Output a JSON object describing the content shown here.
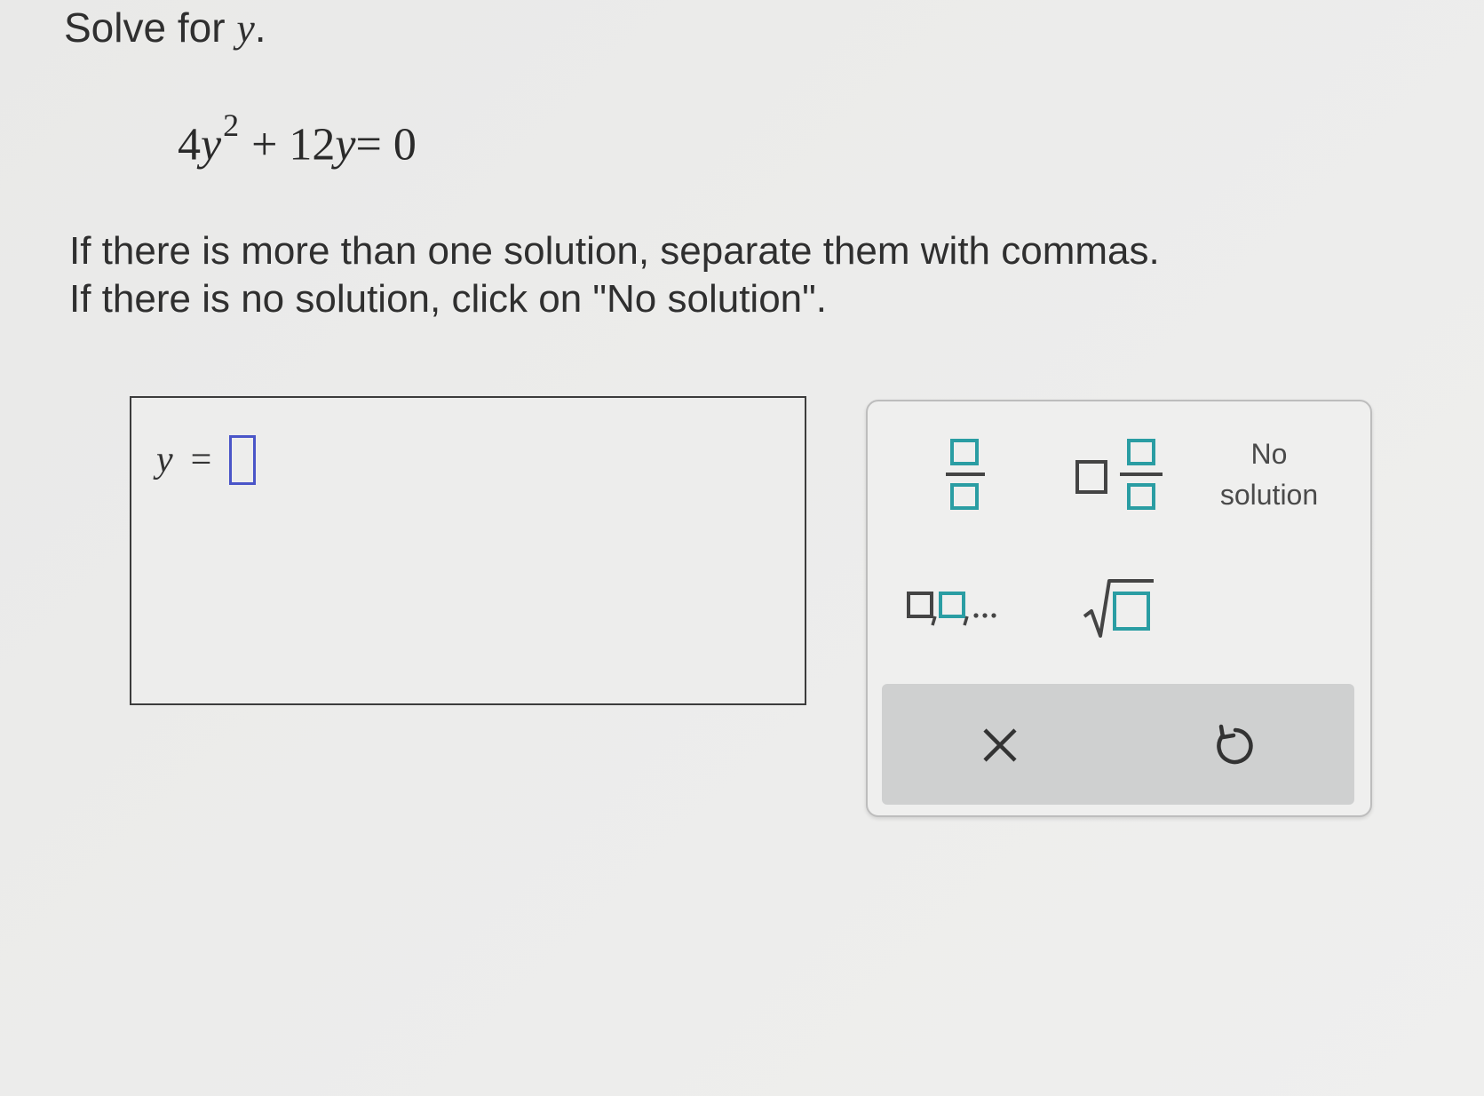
{
  "prompt": {
    "lead": "Solve for ",
    "variable": "y",
    "tail": "."
  },
  "equation": {
    "coef1": "4",
    "var1": "y",
    "exponent": "2",
    "op": "+ 12",
    "var2": "y",
    "rhs": "= 0"
  },
  "instructions": {
    "line1": "If there is more than one solution, separate them with commas.",
    "line2": "If there is no solution, click on \"No solution\"."
  },
  "answer": {
    "variable": "y",
    "equals": "=",
    "value": ""
  },
  "keypad": {
    "no_solution_line1": "No",
    "no_solution_line2": "solution",
    "icons": [
      "fraction-icon",
      "mixed-number-icon",
      "list-icon",
      "square-root-icon",
      "clear-icon",
      "undo-icon"
    ],
    "accent_color": "#2a9da3"
  }
}
